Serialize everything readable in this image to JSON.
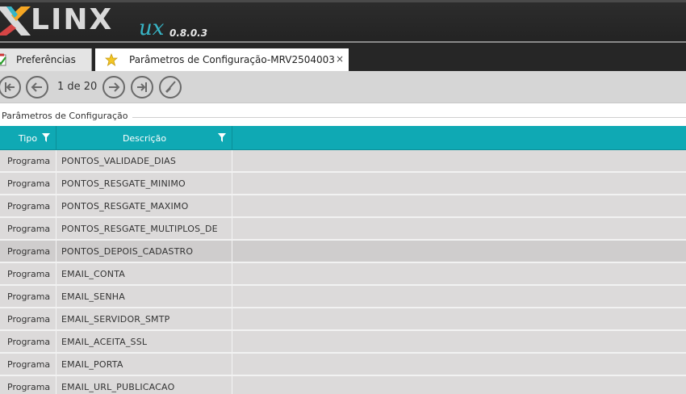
{
  "app": {
    "logo_text": "LINX",
    "logo_ux": "ux",
    "version": "0.8.0.3"
  },
  "tabs": [
    {
      "label": "Preferências",
      "icon": "preferences-checklist-icon"
    },
    {
      "label": "Parâmetros de Configuração-MRV2504003",
      "icon": "star-icon",
      "close": "×"
    }
  ],
  "toolbar": {
    "first_icon": "first-page-icon",
    "prev_icon": "previous-page-icon",
    "page_indicator": "1 de 20",
    "next_icon": "next-page-icon",
    "last_icon": "last-page-icon",
    "clear_icon": "broom-icon"
  },
  "section": {
    "title": "Parâmetros de Configuração"
  },
  "grid": {
    "columns": [
      {
        "label": "Tipo",
        "filter_icon": "filter-icon"
      },
      {
        "label": "Descrição",
        "filter_icon": "filter-icon"
      },
      {
        "label": ""
      }
    ],
    "rows": [
      {
        "tipo": "Programa",
        "descricao": "PONTOS_VALIDADE_DIAS"
      },
      {
        "tipo": "Programa",
        "descricao": "PONTOS_RESGATE_MINIMO"
      },
      {
        "tipo": "Programa",
        "descricao": "PONTOS_RESGATE_MAXIMO"
      },
      {
        "tipo": "Programa",
        "descricao": "PONTOS_RESGATE_MULTIPLOS_DE"
      },
      {
        "tipo": "Programa",
        "descricao": "PONTOS_DEPOIS_CADASTRO"
      },
      {
        "tipo": "Programa",
        "descricao": "EMAIL_CONTA"
      },
      {
        "tipo": "Programa",
        "descricao": "EMAIL_SENHA"
      },
      {
        "tipo": "Programa",
        "descricao": "EMAIL_SERVIDOR_SMTP"
      },
      {
        "tipo": "Programa",
        "descricao": "EMAIL_ACEITA_SSL"
      },
      {
        "tipo": "Programa",
        "descricao": "EMAIL_PORTA"
      },
      {
        "tipo": "Programa",
        "descricao": "EMAIL_URL_PUBLICACAO"
      }
    ],
    "selected_row": 4
  },
  "colors": {
    "header_bg": "#262626",
    "accent_teal": "#0fa9b4",
    "logo_orange": "#f5a623",
    "logo_blue": "#38b5c6",
    "row_bg": "#dcdada"
  }
}
